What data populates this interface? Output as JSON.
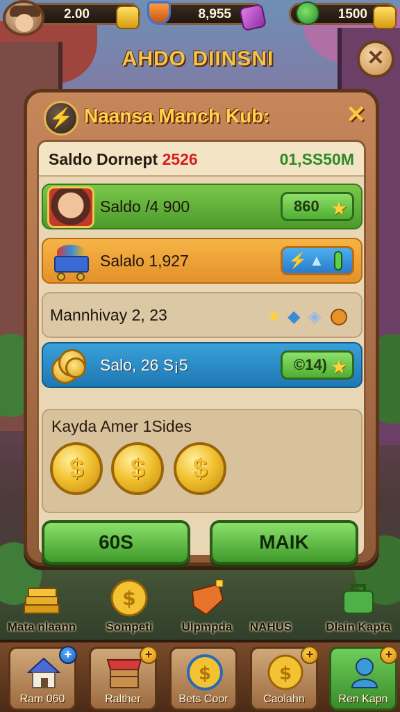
{
  "hud": {
    "coins_value": "2.00",
    "gems_value": "8,955",
    "energy_value": "1500",
    "banner_title": "AHDO DIINSNI"
  },
  "panel": {
    "title": "Naansa Manch Kub:",
    "saldo_label": "Saldo Dornept",
    "saldo_red": "2526",
    "saldo_green": "01,SS50M"
  },
  "rows": [
    {
      "label": "Saldo /4 900",
      "button": "860",
      "icon": "hero-portrait-icon"
    },
    {
      "label": "Salalo 1,927",
      "icon": "mine-cart-icon"
    },
    {
      "label": "Mannhivay 2, 23",
      "icon": "gems-set-icon"
    },
    {
      "label": "Salo, 26 S¡5",
      "button": "©14)",
      "icon": "coin-stack-icon"
    }
  ],
  "prize": {
    "title": "Kayda Amer 1Sides",
    "coins": [
      "$",
      "$",
      "$"
    ]
  },
  "actions": {
    "left": "60S",
    "right": "MAIK"
  },
  "shop": [
    {
      "label": "Mata nlaann",
      "icon": "gold-bars-icon"
    },
    {
      "label": "Sompeti",
      "icon": "coin-icon"
    },
    {
      "label": "Ulpmpda",
      "icon": "chest-icon"
    },
    {
      "label": "NAHUS",
      "icon": "none"
    },
    {
      "label": "Dlain Kapta",
      "icon": "bag-icon"
    }
  ],
  "nav": [
    {
      "label": "Ram 060",
      "icon": "house-icon",
      "badge": "+"
    },
    {
      "label": "Ralther",
      "icon": "shop-stall-icon",
      "badge": "+"
    },
    {
      "label": "Bets Coor",
      "icon": "coin-icon",
      "badge": ""
    },
    {
      "label": "Caolahn",
      "icon": "coin-icon",
      "badge": "+"
    },
    {
      "label": "Ren Kapn",
      "icon": "user-icon",
      "badge": "+"
    }
  ],
  "colors": {
    "accent_gold": "#ffd23a",
    "panel_brown": "#8f5a38",
    "green_button": "#4fae32",
    "blue_row": "#1e78b4",
    "saldo_red": "#d62020",
    "saldo_green": "#2e8a24"
  }
}
